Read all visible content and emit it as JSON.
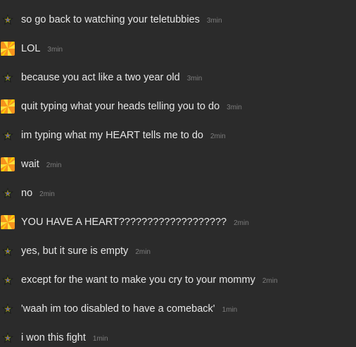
{
  "messages": [
    {
      "avatar": "rainbow-star-icon",
      "text": "so go back to watching your teletubbies",
      "time": "3min"
    },
    {
      "avatar": "orange-pinwheel-icon",
      "text": "LOL",
      "time": "3min"
    },
    {
      "avatar": "rainbow-star-icon",
      "text": "because you act like a two year old",
      "time": "3min"
    },
    {
      "avatar": "orange-pinwheel-icon",
      "text": "quit typing what your heads telling you to do",
      "time": "3min"
    },
    {
      "avatar": "rainbow-star-icon",
      "text": "im typing what my HEART tells me to do",
      "time": "2min"
    },
    {
      "avatar": "orange-pinwheel-icon",
      "text": "wait",
      "time": "2min"
    },
    {
      "avatar": "rainbow-star-icon",
      "text": "no",
      "time": "2min"
    },
    {
      "avatar": "orange-pinwheel-icon",
      "text": "YOU HAVE A HEART???????????????????",
      "time": "2min"
    },
    {
      "avatar": "rainbow-star-icon",
      "text": "yes, but it sure is empty",
      "time": "2min"
    },
    {
      "avatar": "rainbow-star-icon",
      "text": "except for the want to make you cry to your mommy",
      "time": "2min"
    },
    {
      "avatar": "rainbow-star-icon",
      "text": "'waah im too disabled to have a comeback'",
      "time": "1min"
    },
    {
      "avatar": "rainbow-star-icon",
      "text": "i won this fight",
      "time": "1min"
    }
  ],
  "colors": {
    "background": "#2b2b2b",
    "message_text": "#e6e6e6",
    "timestamp": "#7d7d7d",
    "pinwheel_orange": "#f7941d",
    "pinwheel_yellow": "#ffe03a"
  }
}
